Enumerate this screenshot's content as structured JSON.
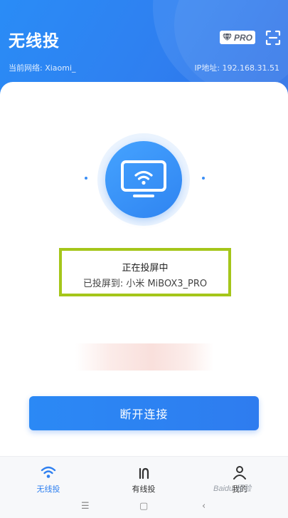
{
  "header": {
    "title": "无线投",
    "pro_label": "PRO",
    "network": "当前网络: Xiaomi_",
    "ip": "IP地址: 192.168.31.51"
  },
  "cast": {
    "status_title": "正在投屏中",
    "status_detail": "已投屏到: 小米 MiBOX3_PRO"
  },
  "actions": {
    "disconnect_label": "断开连接"
  },
  "nav": {
    "items": [
      {
        "label": "无线投",
        "icon": "wifi-icon",
        "active": true
      },
      {
        "label": "有线投",
        "icon": "cable-icon",
        "active": false
      },
      {
        "label": "我的",
        "icon": "person-icon",
        "active": false
      }
    ]
  },
  "watermark": "Baidu 经验",
  "colors": {
    "primary": "#2f80f0",
    "highlight_border": "#a5c61a"
  }
}
